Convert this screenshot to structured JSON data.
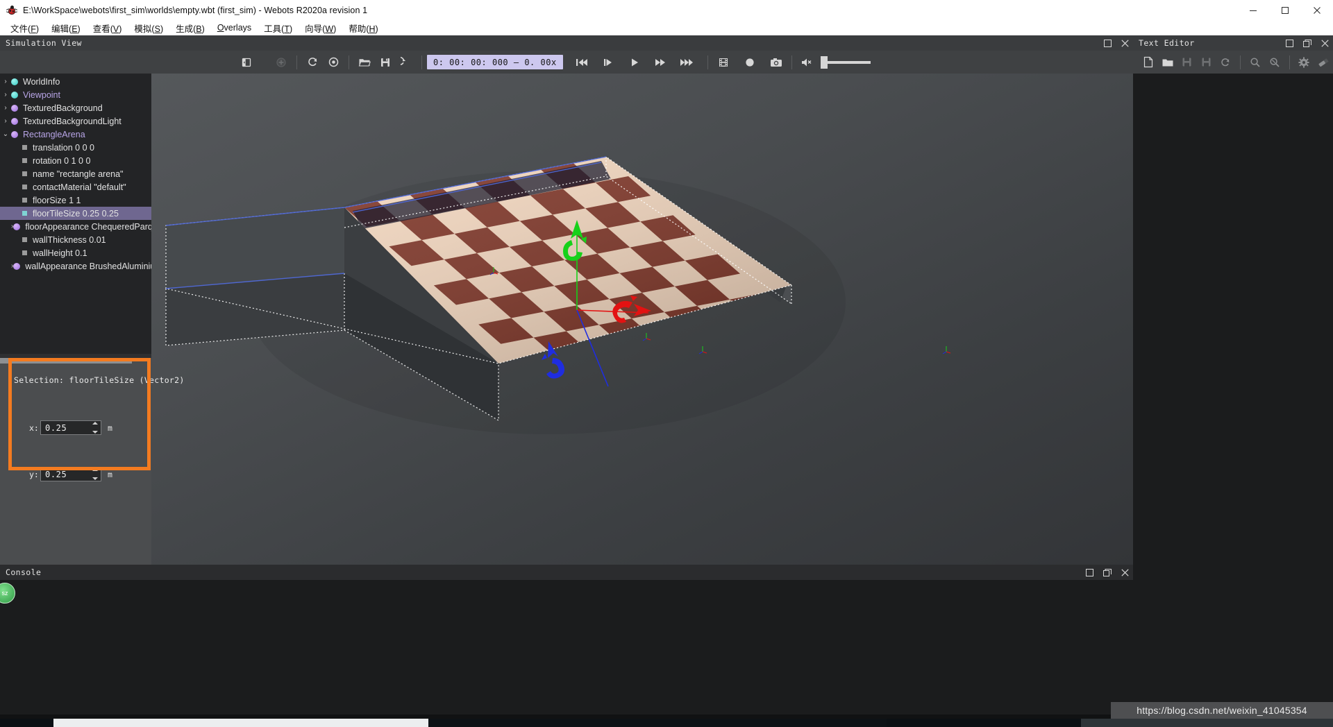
{
  "window": {
    "title": "E:\\WorkSpace\\webots\\first_sim\\worlds\\empty.wbt (first_sim) - Webots R2020a revision 1",
    "app_icon": "webots-bug-icon",
    "minimize_label": "Minimize",
    "maximize_label": "Maximize",
    "close_label": "Close"
  },
  "menubar": {
    "items": [
      {
        "label": "文件",
        "mnemonic": "F"
      },
      {
        "label": "编辑",
        "mnemonic": "E"
      },
      {
        "label": "查看",
        "mnemonic": "V"
      },
      {
        "label": "模拟",
        "mnemonic": "S"
      },
      {
        "label": "生成",
        "mnemonic": "B"
      },
      {
        "label": "",
        "mnemonic": "O",
        "literal": "Overlays"
      },
      {
        "label": "工具",
        "mnemonic": "T"
      },
      {
        "label": "向导",
        "mnemonic": "W"
      },
      {
        "label": "帮助",
        "mnemonic": "H"
      }
    ]
  },
  "simulation_panel": {
    "title": "Simulation View",
    "float_label": "Float",
    "close_label": "Close"
  },
  "toolbar": {
    "time_display": "0: 00: 00: 000   —   0. 00x",
    "time_value": "0:00:00:000",
    "speed_value": "0.00x",
    "buttons": [
      {
        "name": "toggle-scene-tree-icon",
        "title": "Toggle scene tree"
      },
      {
        "name": "add-node-icon",
        "title": "Add node"
      },
      {
        "name": "reload-world-icon",
        "title": "Reload world"
      },
      {
        "name": "reset-simulation-icon",
        "title": "Reset simulation"
      },
      {
        "name": "open-world-icon",
        "title": "Open world"
      },
      {
        "name": "save-world-icon",
        "title": "Save world"
      },
      {
        "name": "revert-world-icon",
        "title": "Revert world"
      },
      {
        "name": "rewind-icon",
        "title": "Rewind"
      },
      {
        "name": "step-icon",
        "title": "Step"
      },
      {
        "name": "play-icon",
        "title": "Play"
      },
      {
        "name": "fast-forward-icon",
        "title": "Fast forward"
      },
      {
        "name": "run-icon",
        "title": "Run"
      },
      {
        "name": "movie-icon",
        "title": "Make movie"
      },
      {
        "name": "record-icon",
        "title": "Record animation"
      },
      {
        "name": "screenshot-icon",
        "title": "Take screenshot"
      },
      {
        "name": "mute-icon",
        "title": "Sound muted"
      }
    ],
    "volume_label": "Volume"
  },
  "scene_tree": {
    "nodes": [
      {
        "label": "WorldInfo",
        "type": "node",
        "dot": "cyan",
        "twisty": "collapsed",
        "indent": 0,
        "selected": false,
        "style": "plain"
      },
      {
        "label": "Viewpoint",
        "type": "node",
        "dot": "cyan",
        "twisty": "collapsed",
        "indent": 0,
        "selected": false,
        "style": "violet"
      },
      {
        "label": "TexturedBackground",
        "type": "node",
        "dot": "violet",
        "twisty": "collapsed",
        "indent": 0,
        "selected": false,
        "style": "plain"
      },
      {
        "label": "TexturedBackgroundLight",
        "type": "node",
        "dot": "violet",
        "twisty": "collapsed",
        "indent": 0,
        "selected": false,
        "style": "plain"
      },
      {
        "label": "RectangleArena",
        "type": "node",
        "dot": "violet",
        "twisty": "expanded",
        "indent": 0,
        "selected": false,
        "style": "violet"
      },
      {
        "label": "translation 0 0 0",
        "type": "field",
        "twisty": "none",
        "indent": 1,
        "selected": false,
        "style": "plain"
      },
      {
        "label": "rotation 0 1 0 0",
        "type": "field",
        "twisty": "none",
        "indent": 1,
        "selected": false,
        "style": "plain"
      },
      {
        "label": "name \"rectangle arena\"",
        "type": "field",
        "twisty": "none",
        "indent": 1,
        "selected": false,
        "style": "plain"
      },
      {
        "label": "contactMaterial \"default\"",
        "type": "field",
        "twisty": "none",
        "indent": 1,
        "selected": false,
        "style": "plain"
      },
      {
        "label": "floorSize 1 1",
        "type": "field",
        "twisty": "none",
        "indent": 1,
        "selected": false,
        "style": "plain"
      },
      {
        "label": "floorTileSize 0.25 0.25",
        "type": "field",
        "twisty": "none",
        "indent": 1,
        "selected": true,
        "style": "plain"
      },
      {
        "label": "floorAppearance ChequeredParqu",
        "type": "node",
        "dot": "violet",
        "twisty": "collapsed",
        "indent": 1,
        "selected": false,
        "style": "plain"
      },
      {
        "label": "wallThickness 0.01",
        "type": "field",
        "twisty": "none",
        "indent": 1,
        "selected": false,
        "style": "plain"
      },
      {
        "label": "wallHeight 0.1",
        "type": "field",
        "twisty": "none",
        "indent": 1,
        "selected": false,
        "style": "plain"
      },
      {
        "label": "wallAppearance BrushedAluminiu",
        "type": "node",
        "dot": "violet",
        "twisty": "collapsed",
        "indent": 1,
        "selected": false,
        "style": "plain"
      }
    ]
  },
  "field_editor": {
    "selection_text": "Selection: floorTileSize (Vector2)",
    "x_label": "x:",
    "x_value": "0.25",
    "x_unit": "m",
    "y_label": "y:",
    "y_value": "0.25",
    "y_unit": "m"
  },
  "annotation": {
    "color": "#f47b20",
    "shape": "rectangle-highlight"
  },
  "console_panel": {
    "title": "Console",
    "float_label": "Float",
    "close_label": "Close"
  },
  "text_editor_panel": {
    "title": "Text Editor",
    "float_label": "Float",
    "close_label": "Close",
    "buttons": [
      {
        "name": "new-file-icon",
        "title": "New"
      },
      {
        "name": "open-file-icon",
        "title": "Open"
      },
      {
        "name": "save-file-icon",
        "title": "Save"
      },
      {
        "name": "save-all-icon",
        "title": "Save all"
      },
      {
        "name": "revert-file-icon",
        "title": "Revert"
      },
      {
        "name": "find-icon",
        "title": "Find"
      },
      {
        "name": "find-replace-icon",
        "title": "Find and replace"
      },
      {
        "name": "build-gear-icon",
        "title": "Build"
      },
      {
        "name": "clean-icon",
        "title": "Clean"
      }
    ]
  },
  "viewport": {
    "scene_name": "RectangleArena checkerboard floor with selection gizmo",
    "gizmo": {
      "x_axis_color": "#e31212",
      "y_axis_color": "#17d11a",
      "z_axis_color": "#1f2de0"
    },
    "floor_light_color": "#f0d3bb",
    "floor_dark_color": "#7e3527",
    "wall_color": "#3f4245"
  },
  "watermark": {
    "text": "https://blog.csdn.net/weixin_41045354"
  },
  "badge": {
    "text": "sz"
  }
}
